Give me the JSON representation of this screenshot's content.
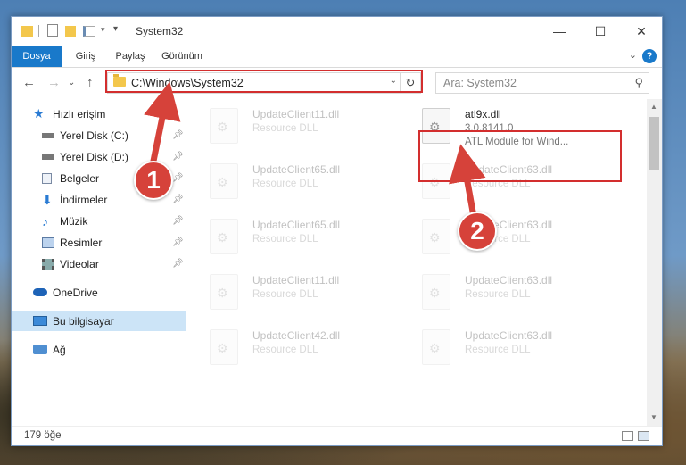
{
  "window": {
    "title": "System32",
    "controls": [
      "—",
      "☐",
      "✕"
    ]
  },
  "ribbon": {
    "tabs": [
      "Dosya",
      "Giriş",
      "Paylaş",
      "Görünüm"
    ],
    "active_tab": "Dosya",
    "help": "?"
  },
  "nav": {
    "address": "C:\\Windows\\System32",
    "search_placeholder": "Ara: System32"
  },
  "sidebar": {
    "items": [
      {
        "label": "Hızlı erişim",
        "icon": "star-icon",
        "pinned": false
      },
      {
        "label": "Yerel Disk (C:)",
        "icon": "drive-icon",
        "pinned": true
      },
      {
        "label": "Yerel Disk (D:)",
        "icon": "drive-icon",
        "pinned": true
      },
      {
        "label": "Belgeler",
        "icon": "documents-icon",
        "pinned": true
      },
      {
        "label": "İndirmeler",
        "icon": "download-icon",
        "pinned": true
      },
      {
        "label": "Müzik",
        "icon": "music-icon",
        "pinned": true
      },
      {
        "label": "Resimler",
        "icon": "pictures-icon",
        "pinned": true
      },
      {
        "label": "Videolar",
        "icon": "video-icon",
        "pinned": true
      },
      {
        "label": "OneDrive",
        "icon": "cloud-icon",
        "pinned": false
      },
      {
        "label": "Bu bilgisayar",
        "icon": "computer-icon",
        "pinned": false
      },
      {
        "label": "Ağ",
        "icon": "network-icon",
        "pinned": false
      }
    ],
    "selected": "Bu bilgisayar"
  },
  "files": {
    "highlighted": {
      "name": "atl9x.dll",
      "version": "3.0.8141.0",
      "description": "ATL Module for Wind..."
    },
    "faded": [
      {
        "name": "UpdateClient11.dll",
        "type": "Resource DLL"
      },
      {
        "name": "UpdateClient65.dll",
        "type": "Resource DLL"
      },
      {
        "name": "UpdateClient63.dll",
        "type": "Resource DLL"
      },
      {
        "name": "UpdateClient65.dll",
        "type": "Resource DLL"
      },
      {
        "name": "UpdateClient63.dll",
        "type": "Resource DLL"
      },
      {
        "name": "UpdateClient11.dll",
        "type": "Resource DLL"
      },
      {
        "name": "UpdateClient63.dll",
        "type": "Resource DLL"
      },
      {
        "name": "UpdateClient42.dll",
        "type": "Resource DLL"
      },
      {
        "name": "UpdateClient63.dll",
        "type": "Resource DLL"
      }
    ]
  },
  "status": {
    "item_count": "179 öğe"
  },
  "annotations": {
    "marker1": "1",
    "marker2": "2",
    "color": "#d32e2e"
  }
}
